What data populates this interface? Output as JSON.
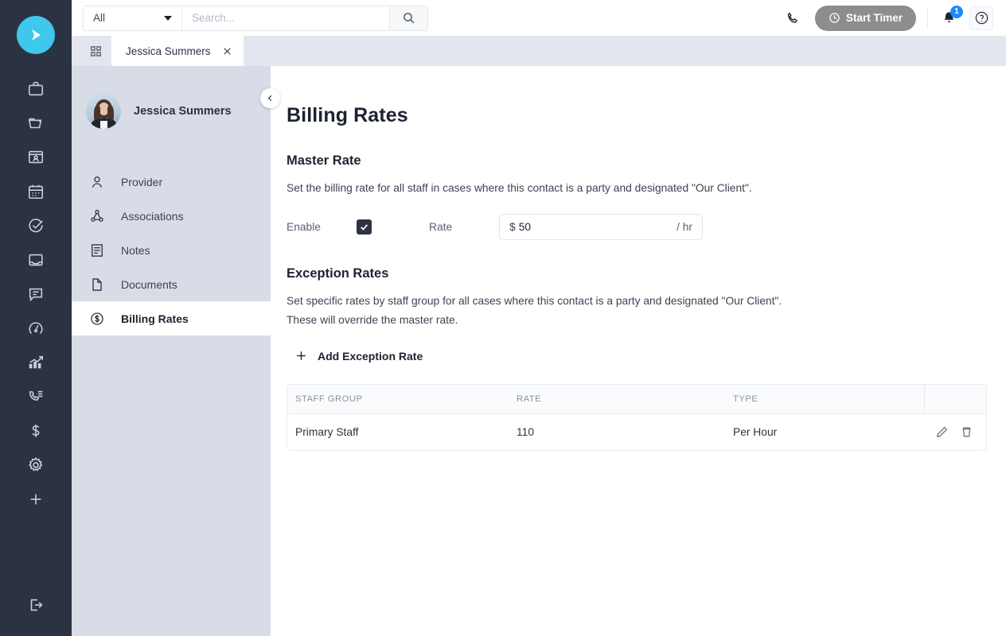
{
  "brand": {
    "logo_icon": "play-triangle-logo",
    "accent_color": "#3fc7ec",
    "rail_color": "#2b3242"
  },
  "rail": {
    "items": [
      {
        "icon": "briefcase-icon",
        "name": "rail-item-matters"
      },
      {
        "icon": "folder-icon",
        "name": "rail-item-files"
      },
      {
        "icon": "contact-card-icon",
        "name": "rail-item-contacts"
      },
      {
        "icon": "calendar-icon",
        "name": "rail-item-calendar"
      },
      {
        "icon": "check-circle-icon",
        "name": "rail-item-tasks"
      },
      {
        "icon": "inbox-icon",
        "name": "rail-item-inbox"
      },
      {
        "icon": "chat-icon",
        "name": "rail-item-messages"
      },
      {
        "icon": "speedometer-icon",
        "name": "rail-item-dashboard"
      },
      {
        "icon": "bar-chart-icon",
        "name": "rail-item-reports"
      },
      {
        "icon": "phone-list-icon",
        "name": "rail-item-calls"
      },
      {
        "icon": "dollar-icon",
        "name": "rail-item-billing"
      },
      {
        "icon": "gear-icon",
        "name": "rail-item-settings"
      },
      {
        "icon": "plus-icon",
        "name": "rail-item-add"
      }
    ],
    "logout_icon": "logout-icon"
  },
  "topbar": {
    "search_scope": "All",
    "search_placeholder": "Search...",
    "search_value": "",
    "search_icon": "search-icon",
    "phone_icon": "phone-icon",
    "timer_label": "Start Timer",
    "timer_icon": "clock-icon",
    "timer_color": "#8d8d8d",
    "bell_icon": "bell-icon",
    "notification_count": "1",
    "badge_color": "#1a8cff",
    "help_label": "?"
  },
  "tabstrip": {
    "grid_icon": "grid-icon",
    "tabs": [
      {
        "label": "Jessica Summers",
        "close_icon": "close-icon",
        "active": true
      }
    ]
  },
  "subnav": {
    "collapse_icon": "chevron-left-icon",
    "profile_name": "Jessica Summers",
    "avatar": "user-avatar",
    "items": [
      {
        "label": "Provider",
        "icon": "person-icon"
      },
      {
        "label": "Associations",
        "icon": "network-icon"
      },
      {
        "label": "Notes",
        "icon": "notes-icon"
      },
      {
        "label": "Documents",
        "icon": "document-icon"
      },
      {
        "label": "Billing Rates",
        "icon": "dollar-circle-icon"
      }
    ],
    "active_index": 4
  },
  "main": {
    "page_title": "Billing Rates",
    "master": {
      "title": "Master Rate",
      "description": "Set the billing rate for all staff in cases where this contact is a party and designated \"Our Client\".",
      "enable_label": "Enable",
      "enable_checked": true,
      "rate_label": "Rate",
      "currency_symbol": "$",
      "rate_value": "50",
      "rate_unit": "/ hr"
    },
    "exception": {
      "title": "Exception Rates",
      "description_line1": "Set specific rates by staff group for all cases where this contact is a party and designated \"Our Client\".",
      "description_line2": "These will override the master rate.",
      "add_label": "Add Exception Rate",
      "add_icon": "plus-icon",
      "columns": [
        "STAFF GROUP",
        "RATE",
        "TYPE"
      ],
      "rows": [
        {
          "staff_group": "Primary Staff",
          "rate": "110",
          "type": "Per Hour",
          "edit_icon": "pencil-icon",
          "delete_icon": "trash-icon"
        }
      ]
    }
  }
}
